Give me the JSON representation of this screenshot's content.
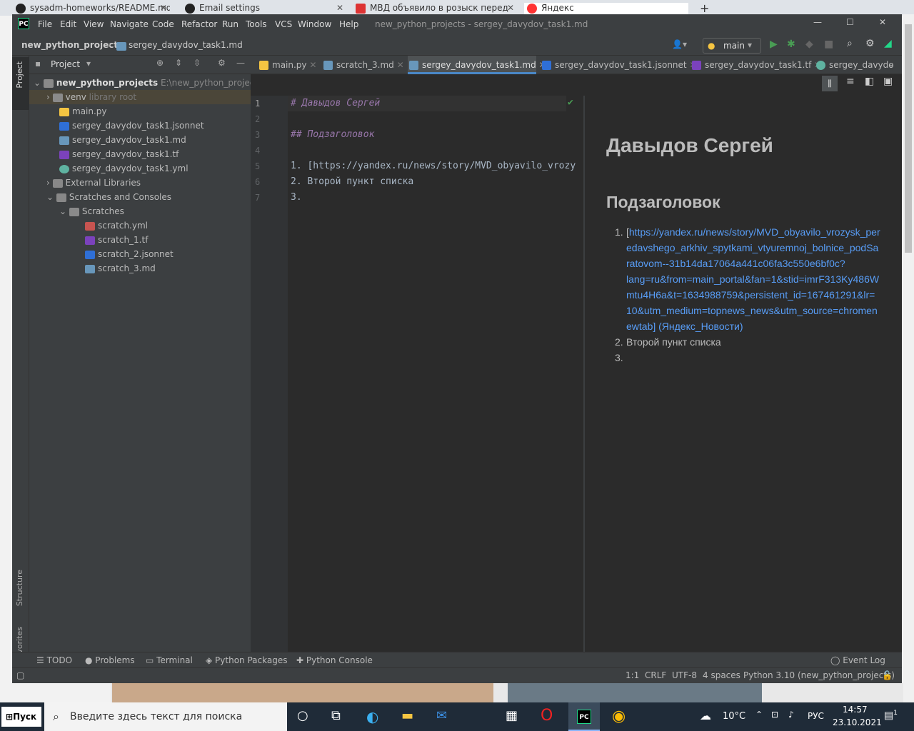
{
  "browser_tabs": [
    {
      "label": "sysadm-homeworks/README.md"
    },
    {
      "label": "Email settings"
    },
    {
      "label": "МВД объявило в розыск перед"
    },
    {
      "label": "Яндекс"
    }
  ],
  "ide": {
    "logo": "PC",
    "menu": [
      "File",
      "Edit",
      "View",
      "Navigate",
      "Code",
      "Refactor",
      "Run",
      "Tools",
      "VCS",
      "Window",
      "Help"
    ],
    "window_title": "new_python_projects - sergey_davydov_task1.md",
    "breadcrumb": {
      "project": "new_python_projects",
      "file": "sergey_davydov_task1.md"
    },
    "run_config": "main",
    "left_strip": {
      "project": "Project",
      "structure": "Structure",
      "favorites": "Favorites"
    },
    "project_panel": {
      "title": "Project",
      "root": {
        "name": "new_python_projects",
        "path": "E:\\new_python_projects"
      },
      "venv": {
        "name": "venv",
        "note": "library root"
      },
      "files": [
        "main.py",
        "sergey_davydov_task1.jsonnet",
        "sergey_davydov_task1.md",
        "sergey_davydov_task1.tf",
        "sergey_davydov_task1.yml"
      ],
      "external_libraries": "External Libraries",
      "scratches_and_consoles": "Scratches and Consoles",
      "scratches": "Scratches",
      "scratch_files": [
        "scratch.yml",
        "scratch_1.tf",
        "scratch_2.jsonnet",
        "scratch_3.md"
      ]
    },
    "editor_tabs": [
      "main.py",
      "scratch_3.md",
      "sergey_davydov_task1.md",
      "sergey_davydov_task1.jsonnet",
      "sergey_davydov_task1.tf",
      "sergey_davydo"
    ],
    "code_lines": [
      "# Давыдов Сергей",
      "",
      "## Подзаголовок",
      "",
      "1. [https://yandex.ru/news/story/MVD_obyavilo_vrozy",
      "2. Второй пункт списка",
      "3."
    ],
    "line_numbers": [
      "1",
      "2",
      "3",
      "4",
      "5",
      "6",
      "7"
    ],
    "preview": {
      "h1": "Давыдов Сергей",
      "h2": "Подзаголовок",
      "list": [
        {
          "num": "1.",
          "bracket": "[",
          "link_lines": [
            "https://yandex.ru/news/story/MVD_obyavilo_vrozysk_per",
            "edavshego_arkhiv_spytkami_vtyuremnoj_bolnice_podSa",
            "ratovom--31b14da17064a441c06fa3c550e6bf0c?",
            "lang=ru&from=main_portal&fan=1&stid=imrF313Ky486W",
            "mtu4H6a&t=1634988759&persistent_id=167461291&lr=",
            "10&utm_medium=topnews_news&utm_source=chromen",
            "ewtab] (Яндекс_Новости)"
          ]
        },
        {
          "num": "2.",
          "text": "Второй пункт списка"
        },
        {
          "num": "3.",
          "text": ""
        }
      ]
    },
    "bottom_tools": [
      "TODO",
      "Problems",
      "Terminal",
      "Python Packages",
      "Python Console"
    ],
    "event_log": "Event Log",
    "status": {
      "position": "1:1",
      "line_sep": "CRLF",
      "encoding": "UTF-8",
      "indent": "4 spaces",
      "interpreter": "Python 3.10 (new_python_projects)"
    }
  },
  "taskbar": {
    "start": "Пуск",
    "search_placeholder": "Введите здесь текст для поиска",
    "weather": "10°C",
    "lang": "РУС",
    "time": "14:57",
    "date": "23.10.2021",
    "notifications": "1"
  },
  "colors": {
    "accent": "#4a88c7",
    "link": "#589df6",
    "comment": "#9876aa",
    "ok": "#499c54"
  }
}
